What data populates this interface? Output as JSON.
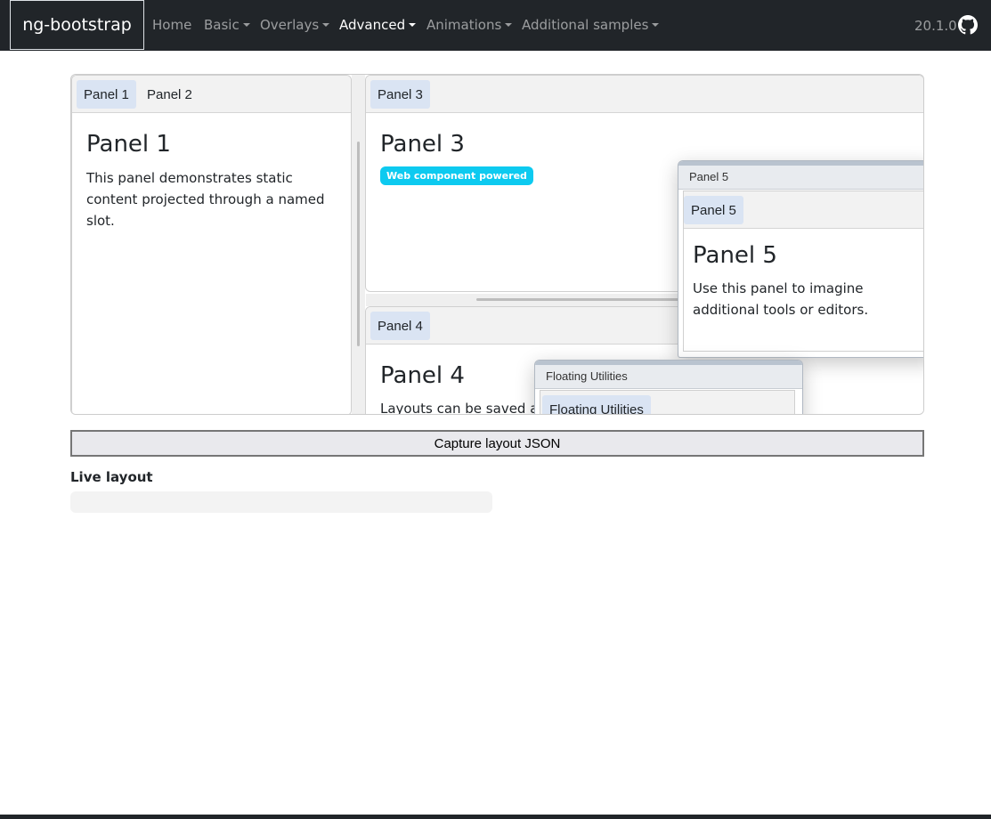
{
  "navbar": {
    "brand": "ng-bootstrap",
    "items": [
      {
        "label": "Home",
        "dropdown": false,
        "active": false
      },
      {
        "label": "Basic",
        "dropdown": true,
        "active": false
      },
      {
        "label": "Overlays",
        "dropdown": true,
        "active": false
      },
      {
        "label": "Advanced",
        "dropdown": true,
        "active": true
      },
      {
        "label": "Animations",
        "dropdown": true,
        "active": false
      },
      {
        "label": "Additional samples",
        "dropdown": true,
        "active": false
      }
    ],
    "version": "20.1.0",
    "github_icon": "github-icon"
  },
  "layout": {
    "left_pane": {
      "tabs": [
        "Panel 1",
        "Panel 2"
      ],
      "selected_tab": "Panel 1",
      "title": "Panel 1",
      "text": "This panel demonstrates static content projected through a named slot."
    },
    "top_right_pane": {
      "tabs": [
        "Panel 3"
      ],
      "title": "Panel 3",
      "badge": "Web component powered"
    },
    "bottom_right_pane": {
      "tabs": [
        "Panel 4"
      ],
      "title": "Panel 4",
      "text": "Layouts can be saved as"
    },
    "float_panel5": {
      "window_title": "Panel 5",
      "tabs": [
        "Panel 5"
      ],
      "title": "Panel 5",
      "text": "Use this panel to imagine additional tools or editors."
    },
    "float_utilities": {
      "window_title": "Floating Utilities",
      "tabs": [
        "Floating Utilities"
      ]
    }
  },
  "actions": {
    "capture_label": "Capture layout JSON"
  },
  "live": {
    "label": "Live layout",
    "value": ""
  },
  "colors": {
    "navbar": "#212529",
    "tab_selected": "#dae4f3",
    "badge": "#0dcaf0"
  }
}
